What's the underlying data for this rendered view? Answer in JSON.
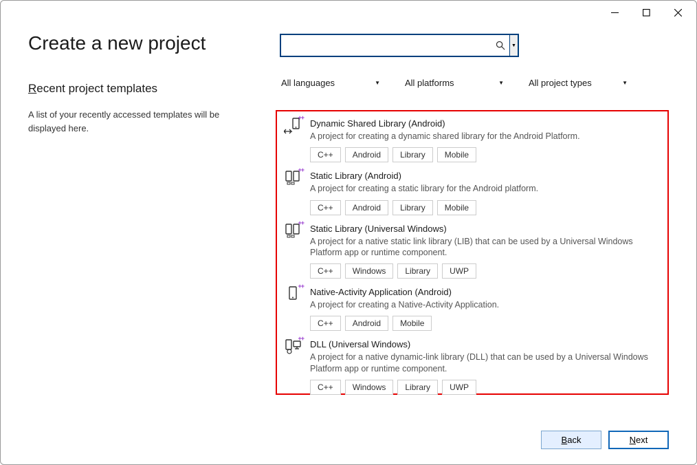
{
  "page": {
    "title": "Create a new project",
    "recent_heading_prefix": "R",
    "recent_heading_rest": "ecent project templates",
    "recent_desc": "A list of your recently accessed templates will be displayed here."
  },
  "search": {
    "value": "",
    "placeholder": ""
  },
  "filters": {
    "languages": "All languages",
    "platforms": "All platforms",
    "types": "All project types"
  },
  "templates": [
    {
      "title": "Dynamic Shared Library (Android)",
      "desc": "A project for creating a dynamic shared library for the Android Platform.",
      "tags": [
        "C++",
        "Android",
        "Library",
        "Mobile"
      ]
    },
    {
      "title": "Static Library (Android)",
      "desc": "A project for creating a static library for the Android platform.",
      "tags": [
        "C++",
        "Android",
        "Library",
        "Mobile"
      ]
    },
    {
      "title": "Static Library (Universal Windows)",
      "desc": "A project for a native static link library (LIB) that can be used by a Universal Windows Platform app or runtime component.",
      "tags": [
        "C++",
        "Windows",
        "Library",
        "UWP"
      ]
    },
    {
      "title": "Native-Activity Application (Android)",
      "desc": "A project for creating a Native-Activity Application.",
      "tags": [
        "C++",
        "Android",
        "Mobile"
      ]
    },
    {
      "title": "DLL (Universal Windows)",
      "desc": "A project for a native dynamic-link library (DLL) that can be used by a Universal Windows Platform app or runtime component.",
      "tags": [
        "C++",
        "Windows",
        "Library",
        "UWP"
      ]
    }
  ],
  "buttons": {
    "back_prefix": "B",
    "back_rest": "ack",
    "next_prefix": "N",
    "next_rest": "ext"
  }
}
